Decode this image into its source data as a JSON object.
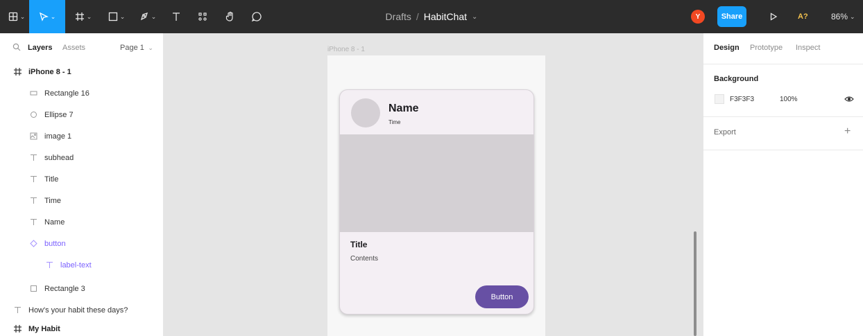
{
  "toolbar": {
    "breadcrumb_parent": "Drafts",
    "breadcrumb_sep": "/",
    "file_name": "HabitChat",
    "avatar_initial": "Y",
    "share_label": "Share",
    "a11y_label": "A?",
    "zoom": "86%",
    "accent": "#18a0fb",
    "avatar_color": "#f24822"
  },
  "left_panel": {
    "tab_layers": "Layers",
    "tab_assets": "Assets",
    "page": "Page 1",
    "layers": [
      {
        "label": "iPhone 8 - 1",
        "icon": "frame-icon"
      },
      {
        "label": "Rectangle 16",
        "icon": "rectangle-icon"
      },
      {
        "label": "Ellipse 7",
        "icon": "ellipse-icon"
      },
      {
        "label": "image 1",
        "icon": "image-icon"
      },
      {
        "label": "subhead",
        "icon": "text-icon"
      },
      {
        "label": "Title",
        "icon": "text-icon"
      },
      {
        "label": "Time",
        "icon": "text-icon"
      },
      {
        "label": "Name",
        "icon": "text-icon"
      },
      {
        "label": "button",
        "icon": "component-instance-icon"
      },
      {
        "label": "label-text",
        "icon": "text-icon"
      },
      {
        "label": "Rectangle 3",
        "icon": "rectangle-icon"
      },
      {
        "label": "How's your habit these days?",
        "icon": "text-icon"
      },
      {
        "label": "My Habit",
        "icon": "frame-icon"
      }
    ]
  },
  "canvas": {
    "frame_label": "iPhone 8 - 1",
    "card": {
      "name": "Name",
      "time": "Time",
      "title": "Title",
      "contents": "Contents",
      "button": "Button",
      "button_color": "#6750a4"
    }
  },
  "right_panel": {
    "tab_design": "Design",
    "tab_prototype": "Prototype",
    "tab_inspect": "Inspect",
    "background_title": "Background",
    "background_hex": "F3F3F3",
    "background_opacity": "100%",
    "export_title": "Export"
  }
}
